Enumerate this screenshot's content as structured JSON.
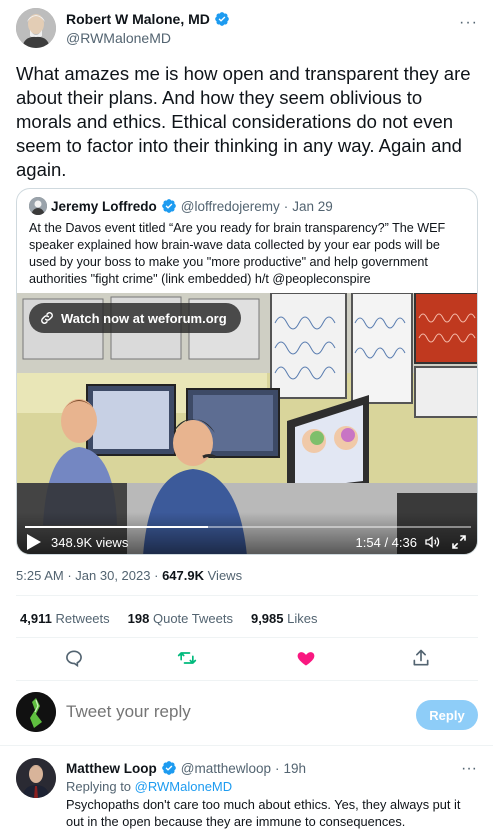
{
  "tweet": {
    "author_name": "Robert W Malone, MD",
    "author_handle": "@RWMaloneMD",
    "more_label": "···",
    "text": "What amazes me is how open and transparent they are about their plans.  And how they seem oblivious to morals and ethics.  Ethical considerations do not even seem to factor into their thinking in any way.  Again and again."
  },
  "quote": {
    "author_name": "Jeremy Loffredo",
    "author_handle": "@loffredojeremy",
    "separator": "·",
    "date": "Jan 29",
    "text": "At the Davos event titled “Are you ready for brain transparency?” The WEF speaker explained how brain-wave data collected by your ear pods will be used by your boss to make you \"more productive\" and help government authorities \"fight crime\" (link embedded) h/t @peopleconspire",
    "media": {
      "watch_label": "Watch now at weforum.org",
      "views": "348.9K views",
      "time": "1:54 / 4:36",
      "progress": 0.41
    }
  },
  "meta": {
    "time": "5:25 AM",
    "date": "Jan 30, 2023",
    "views_count": "647.9K",
    "views_label": "Views",
    "sep": "·"
  },
  "stats": {
    "retweets_count": "4,911",
    "retweets_label": "Retweets",
    "quotes_count": "198",
    "quotes_label": "Quote Tweets",
    "likes_count": "9,985",
    "likes_label": "Likes"
  },
  "actions": {
    "icons": [
      "reply-icon",
      "retweet-icon",
      "like-icon",
      "share-icon"
    ],
    "retweet_color": "#00ba7c",
    "like_color": "#f91880",
    "muted_color": "#536471"
  },
  "compose": {
    "placeholder": "Tweet your reply",
    "button_label": "Reply",
    "button_color": "#8ecdf8"
  },
  "reply": {
    "author_name": "Matthew Loop",
    "author_handle": "@matthewloop",
    "separator": "·",
    "time": "19h",
    "more_label": "···",
    "replying_prefix": "Replying to",
    "replying_handle": "@RWMaloneMD",
    "text": "Psychopaths don't care too much about ethics. Yes, they always put it out in the open because they are immune to consequences."
  },
  "colors": {
    "accent": "#1d9bf0",
    "text": "#0f1419",
    "muted": "#536471",
    "border": "#cfd9de"
  }
}
